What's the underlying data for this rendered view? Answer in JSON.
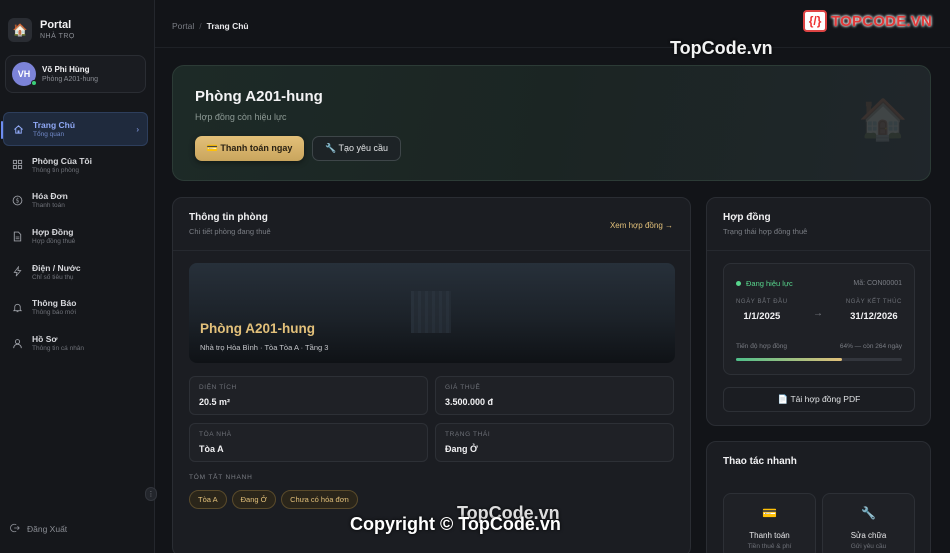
{
  "brand": {
    "title": "Portal",
    "subtitle": "NHÀ TRỌ",
    "logo_icon": "house-icon"
  },
  "user": {
    "initials": "VH",
    "name": "Võ Phi Hùng",
    "room": "Phòng A201-hung"
  },
  "nav": [
    {
      "label": "Trang Chủ",
      "sub": "Tổng quan",
      "icon": "home-icon",
      "active": true
    },
    {
      "label": "Phòng Của Tôi",
      "sub": "Thông tin phòng",
      "icon": "grid-icon"
    },
    {
      "label": "Hóa Đơn",
      "sub": "Thanh toán",
      "icon": "dollar-icon"
    },
    {
      "label": "Hợp Đồng",
      "sub": "Hợp đồng thuê",
      "icon": "document-icon"
    },
    {
      "label": "Điện / Nước",
      "sub": "Chỉ số tiêu thụ",
      "icon": "lightning-icon"
    },
    {
      "label": "Thông Báo",
      "sub": "Thông báo mới",
      "icon": "bell-icon"
    },
    {
      "label": "Hồ Sơ",
      "sub": "Thông tin cá nhân",
      "icon": "user-icon"
    }
  ],
  "logout_label": "Đăng Xuất",
  "breadcrumb": {
    "root": "Portal",
    "separator": "/",
    "current": "Trang Chủ"
  },
  "watermark": {
    "logo": "{/}",
    "brand": "TOPCODE.VN",
    "url": "TopCode.vn",
    "copyright": "Copyright © TopCode.vn",
    "url2": "TopCode.vn"
  },
  "hero": {
    "title": "Phòng A201-hung",
    "subtitle": "Hợp đồng còn hiệu lực",
    "pay_label": "💳 Thanh toán ngay",
    "request_label": "🔧 Tạo yêu cầu"
  },
  "room": {
    "title": "Thông tin phòng",
    "subtitle": "Chi tiết phòng đang thuê",
    "contract_link": "Xem hợp đồng →",
    "banner_title": "Phòng A201-hung",
    "banner_sub": "Nhà trọ Hòa Bình · Tòa Tòa A · Tầng 3",
    "fields": [
      {
        "label": "DIỆN TÍCH",
        "value": "20.5 m²"
      },
      {
        "label": "GIÁ THUÊ",
        "value": "3.500.000 đ"
      },
      {
        "label": "TÒA NHÀ",
        "value": "Tòa A"
      },
      {
        "label": "TRẠNG THÁI",
        "value": "Đang Ở"
      }
    ],
    "summary_label": "TÓM TẮT NHANH",
    "chips": [
      "Tòa A",
      "Đang Ở",
      "Chưa có hóa đơn"
    ]
  },
  "contract": {
    "title": "Hợp đồng",
    "subtitle": "Trạng thái hợp đồng thuê",
    "status": "Đang hiệu lực",
    "code": "Mã: CON00001",
    "start_label": "NGÀY BẮT ĐẦU",
    "start_value": "1/1/2025",
    "arrow": "→",
    "end_label": "NGÀY KẾT THÚC",
    "end_value": "31/12/2026",
    "progress_label": "Tiến độ hợp đồng",
    "progress_text": "64% — còn 264 ngày",
    "progress_percent": 64,
    "pdf_label": "📄 Tải hợp đồng PDF"
  },
  "quick": {
    "title": "Thao tác nhanh",
    "items": [
      {
        "icon": "card-icon",
        "glyph": "💳",
        "title": "Thanh toán",
        "sub": "Tiền thuê & phí"
      },
      {
        "icon": "wrench-icon",
        "glyph": "🔧",
        "title": "Sửa chữa",
        "sub": "Gửi yêu cầu"
      }
    ]
  },
  "colors": {
    "accent_gold": "#e2c07a",
    "active_blue": "#8fa8f5",
    "status_green": "#58d68d"
  }
}
